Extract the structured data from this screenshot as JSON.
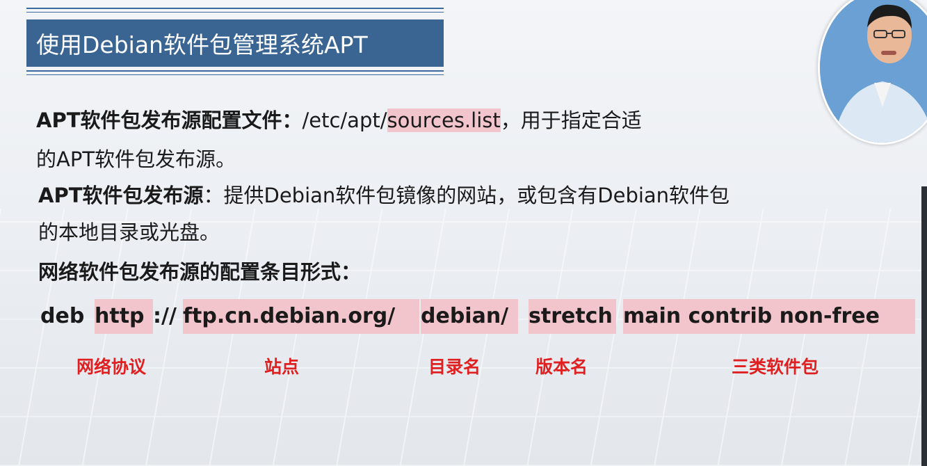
{
  "slide": {
    "title": "使用Debian软件包管理系统APT",
    "p1_bold": "APT软件包发布源配置文件：",
    "p1_path": "/etc/apt/",
    "p1_file": "sources.list",
    "p1_rest": "，用于指定合适",
    "p2": "的APT软件包发布源。",
    "p3_bold": "APT软件包发布源",
    "p3_rest": "：提供Debian软件包镜像的网站，或包含有Debian软件包",
    "p4": "的本地目录或光盘。",
    "p5": "网络软件包发布源的配置条目形式："
  },
  "command": {
    "deb": "deb",
    "protocol": "http",
    "sep": "://",
    "site": "ftp.cn.debian.org/",
    "dir": "debian/",
    "release": "stretch",
    "components": "main contrib non-free"
  },
  "labels": {
    "protocol": "网络协议",
    "site": "站点",
    "dir": "目录名",
    "release": "版本名",
    "components": "三类软件包"
  },
  "colors": {
    "title_bg": "#3a6593",
    "highlight": "#f2c5cc",
    "label_red": "#e02020"
  }
}
